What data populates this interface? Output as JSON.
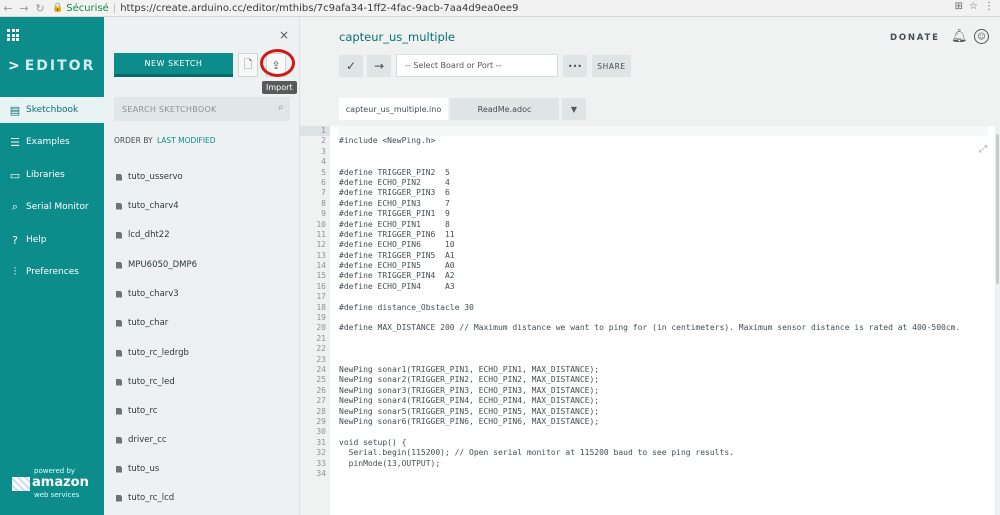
{
  "browser": {
    "secure_label": "Sécurisé",
    "url": "https://create.arduino.cc/editor/mthibs/7c9afa34-1ff2-4fac-9acb-7aa4d9ea0ee9"
  },
  "leftnav": {
    "brand": "EDITOR",
    "items": [
      {
        "label": "Sketchbook",
        "icon": "book-icon"
      },
      {
        "label": "Examples",
        "icon": "list-icon"
      },
      {
        "label": "Libraries",
        "icon": "library-icon"
      },
      {
        "label": "Serial Monitor",
        "icon": "search-icon"
      },
      {
        "label": "Help",
        "icon": "help-icon"
      },
      {
        "label": "Preferences",
        "icon": "sliders-icon"
      }
    ],
    "aws": {
      "line1": "powered by",
      "line2": "amazon",
      "line3": "web services"
    }
  },
  "sketchbook": {
    "new_sketch": "NEW SKETCH",
    "import_tooltip": "Import",
    "search_placeholder": "SEARCH SKETCHBOOK",
    "order_by": "ORDER BY",
    "order_value": "LAST MODIFIED",
    "items": [
      "tuto_usservo",
      "tuto_charv4",
      "lcd_dht22",
      "MPU6050_DMP6",
      "tuto_charv3",
      "tuto_char",
      "tuto_rc_ledrgb",
      "tuto_rc_led",
      "tuto_rc",
      "driver_cc",
      "tuto_us",
      "tuto_rc_lcd"
    ]
  },
  "editor": {
    "sketch_title": "capteur_us_multiple",
    "donate": "DONATE",
    "board_placeholder": "-- Select Board or Port --",
    "more": "•••",
    "share": "SHARE",
    "tabs": [
      "capteur_us_multiple.ino",
      "ReadMe.adoc"
    ],
    "code": [
      "",
      "#include <NewPing.h>",
      "",
      "",
      "#define TRIGGER_PIN2  5",
      "#define ECHO_PIN2     4",
      "#define TRIGGER_PIN3  6",
      "#define ECHO_PIN3     7",
      "#define TRIGGER_PIN1  9",
      "#define ECHO_PIN1     8",
      "#define TRIGGER_PIN6  11",
      "#define ECHO_PIN6     10",
      "#define TRIGGER_PIN5  A1",
      "#define ECHO_PIN5     A0",
      "#define TRIGGER_PIN4  A2",
      "#define ECHO_PIN4     A3",
      "",
      "#define distance_Obstacle 30",
      "",
      "#define MAX_DISTANCE 200 // Maximum distance we want to ping for (in centimeters). Maximum sensor distance is rated at 400-500cm.",
      "",
      "",
      "",
      "NewPing sonar1(TRIGGER_PIN1, ECHO_PIN1, MAX_DISTANCE);",
      "NewPing sonar2(TRIGGER_PIN2, ECHO_PIN2, MAX_DISTANCE);",
      "NewPing sonar3(TRIGGER_PIN3, ECHO_PIN3, MAX_DISTANCE);",
      "NewPing sonar4(TRIGGER_PIN4, ECHO_PIN4, MAX_DISTANCE);",
      "NewPing sonar5(TRIGGER_PIN5, ECHO_PIN5, MAX_DISTANCE);",
      "NewPing sonar6(TRIGGER_PIN6, ECHO_PIN6, MAX_DISTANCE);",
      "",
      "void setup() {",
      "  Serial.begin(115200); // Open serial monitor at 115200 baud to see ping results.",
      "  pinMode(13,OUTPUT);",
      ""
    ],
    "line_numbers": [
      "1",
      "2",
      "3",
      "4",
      "5",
      "6",
      "7",
      "8",
      "9",
      "10",
      "11",
      "12",
      "13",
      "14",
      "15",
      "16",
      "17",
      "18",
      "19",
      "20",
      "21",
      "22",
      "23",
      "24",
      "25",
      "26",
      "27",
      "28",
      "29",
      "30",
      "31",
      "32",
      "33",
      "34"
    ]
  }
}
